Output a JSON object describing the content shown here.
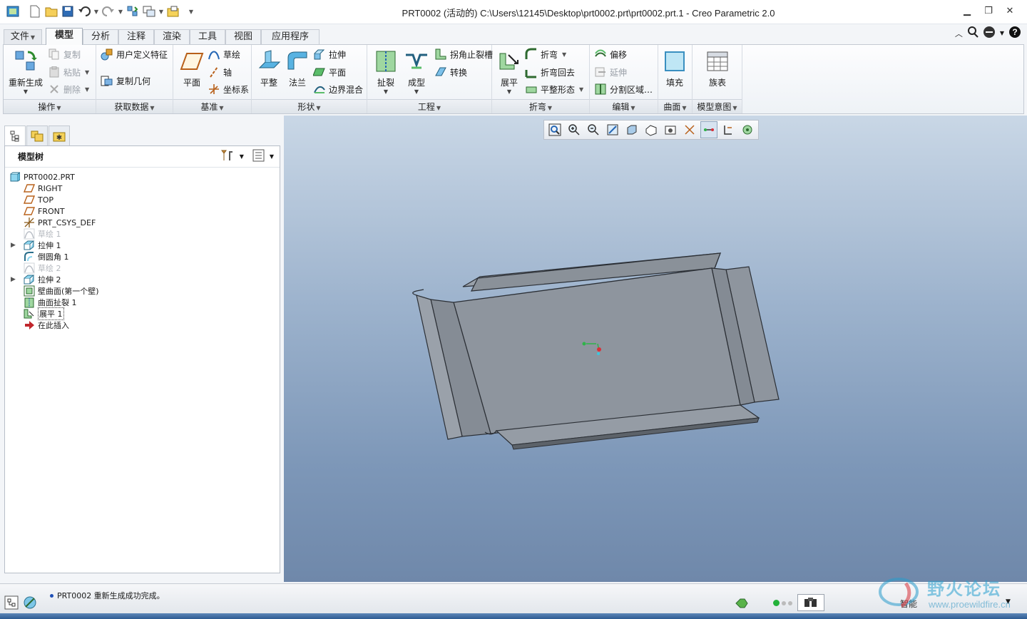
{
  "window": {
    "title": "PRT0002 (活动的) C:\\Users\\12145\\Desktop\\prt0002.prt\\prt0002.prt.1 - Creo Parametric 2.0"
  },
  "quick_access": {
    "icons": [
      "app-icon",
      "new-icon",
      "open-icon",
      "save-icon",
      "undo-icon",
      "redo-icon",
      "regenerate-icon",
      "windows-icon",
      "close-window-icon",
      "customize-icon"
    ]
  },
  "tabs": [
    {
      "label": "文件",
      "id": "file"
    },
    {
      "label": "模型",
      "id": "model"
    },
    {
      "label": "分析",
      "id": "analysis"
    },
    {
      "label": "注释",
      "id": "annotate"
    },
    {
      "label": "渲染",
      "id": "render"
    },
    {
      "label": "工具",
      "id": "tools"
    },
    {
      "label": "视图",
      "id": "view"
    },
    {
      "label": "应用程序",
      "id": "applications"
    }
  ],
  "active_tab": "模型",
  "ribbon": {
    "groups": {
      "operations": "操作",
      "get_data": "获取数据",
      "datum": "基准",
      "shapes": "形状",
      "engineering": "工程",
      "bends": "折弯",
      "editing": "编辑",
      "surfaces": "曲面",
      "model_intent": "模型意图"
    },
    "buttons": {
      "regenerate": "重新生成",
      "copy": "复制",
      "paste": "粘贴",
      "delete": "删除",
      "user_defined_feature": "用户定义特征",
      "copy_geometry": "复制几何",
      "plane": "平面",
      "sketch": "草绘",
      "axis": "轴",
      "csys": "坐标系",
      "flat_wall": "平整",
      "flange": "法兰",
      "extrude": "拉伸",
      "planar": "平面",
      "boundary_blend": "边界混合",
      "rip": "扯裂",
      "form": "成型",
      "corner_relief": "拐角止裂槽",
      "convert": "转换",
      "unbend": "展平",
      "bend": "折弯",
      "bend_back": "折弯回去",
      "flatten_form": "平整形态",
      "offset": "偏移",
      "extend": "延伸",
      "split_area": "分割区域…",
      "fill": "填充",
      "family_table": "族表"
    }
  },
  "colors": {
    "accent": "#1f4fb6",
    "viewport_top": "#c9d7e6",
    "viewport_bottom": "#6f88aa",
    "part_face": "#8e959e",
    "part_edge": "#2b2f35"
  },
  "model_tree": {
    "title": "模型树",
    "items": [
      {
        "label": "PRT0002.PRT",
        "icon": "part-icon"
      },
      {
        "label": "RIGHT",
        "icon": "datum-plane-icon"
      },
      {
        "label": "TOP",
        "icon": "datum-plane-icon"
      },
      {
        "label": "FRONT",
        "icon": "datum-plane-icon"
      },
      {
        "label": "PRT_CSYS_DEF",
        "icon": "csys-icon"
      },
      {
        "label": "草绘 1",
        "icon": "sketch-icon",
        "dim": true
      },
      {
        "label": "拉伸 1",
        "icon": "extrude-icon",
        "expandable": true
      },
      {
        "label": "倒圆角 1",
        "icon": "round-icon"
      },
      {
        "label": "草绘 2",
        "icon": "sketch-icon",
        "dim": true
      },
      {
        "label": "拉伸 2",
        "icon": "extrude-icon",
        "expandable": true
      },
      {
        "label": "壁曲面(第一个壁)",
        "icon": "wall-icon"
      },
      {
        "label": "曲面扯裂 1",
        "icon": "rip-icon"
      },
      {
        "label": "展平 1",
        "icon": "unbend-icon",
        "selected": true
      },
      {
        "label": "在此插入",
        "icon": "insert-here-icon"
      }
    ]
  },
  "status": {
    "message": "PRT0002 重新生成成功完成。",
    "filter": "智能"
  },
  "watermark": {
    "cn": "野火论坛",
    "url": "www.proewildfire.cn"
  }
}
